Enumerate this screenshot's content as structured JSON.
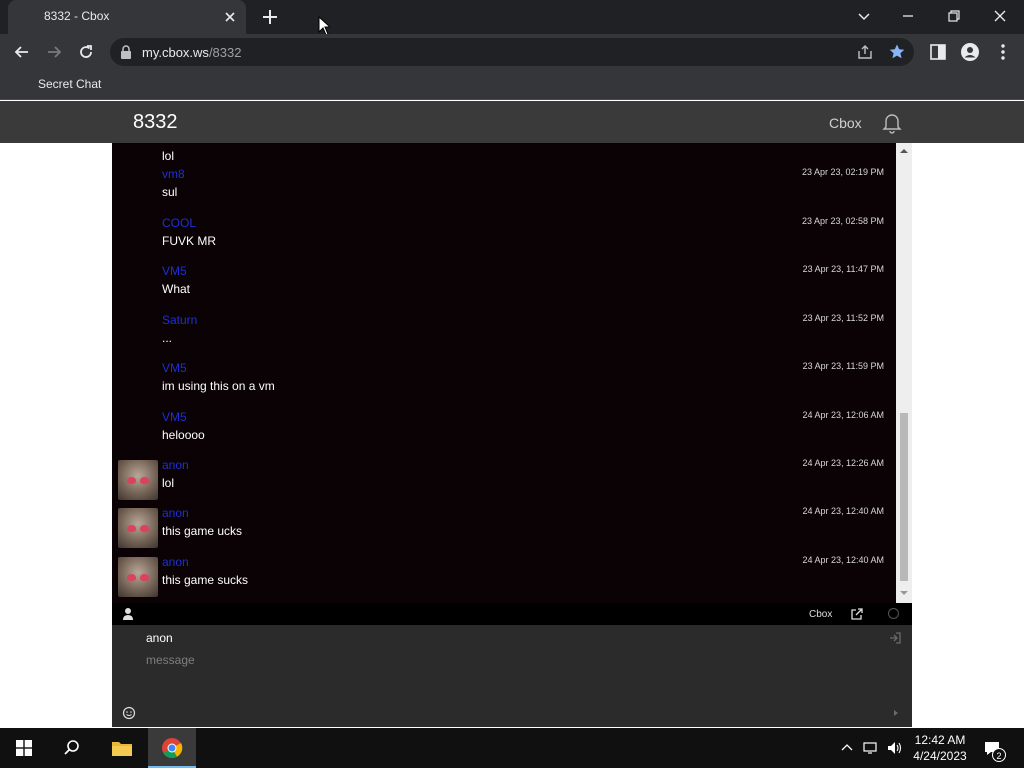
{
  "browser": {
    "tab_title": "8332 - Cbox",
    "url_host": "my.cbox.ws",
    "url_path": "/8332",
    "bookmark": "Secret Chat"
  },
  "page": {
    "title": "8332",
    "brand": "Cbox"
  },
  "messages": [
    {
      "name": "",
      "text": "lol",
      "time": ""
    },
    {
      "name": "vm8",
      "text": "sul",
      "time": "23 Apr 23, 02:19 PM"
    },
    {
      "name": "COOL",
      "text": "FUVK MR",
      "time": "23 Apr 23, 02:58 PM"
    },
    {
      "name": "VM5",
      "text": "What",
      "time": "23 Apr 23, 11:47 PM"
    },
    {
      "name": "Saturn",
      "text": "...",
      "time": "23 Apr 23, 11:52 PM"
    },
    {
      "name": "VM5",
      "text": "im using this on a vm",
      "time": "23 Apr 23, 11:59 PM"
    },
    {
      "name": "VM5",
      "text": "heloooo",
      "time": "24 Apr 23, 12:06 AM"
    },
    {
      "name": "anon",
      "text": "lol",
      "time": "24 Apr 23, 12:26 AM"
    },
    {
      "name": "anon",
      "text": "this game ucks",
      "time": "24 Apr 23, 12:40 AM"
    },
    {
      "name": "anon",
      "text": "this game sucks",
      "time": "24 Apr 23, 12:40 AM"
    }
  ],
  "chat_bar": {
    "link": "Cbox"
  },
  "compose": {
    "name_value": "anon",
    "message_placeholder": "message"
  },
  "taskbar": {
    "time": "12:42 AM",
    "date": "4/24/2023",
    "notification_count": "2"
  },
  "colors": {
    "chat_bg": "#0a0204",
    "name_color": "#1f2fd6",
    "header_bg": "#3a3a3a"
  }
}
